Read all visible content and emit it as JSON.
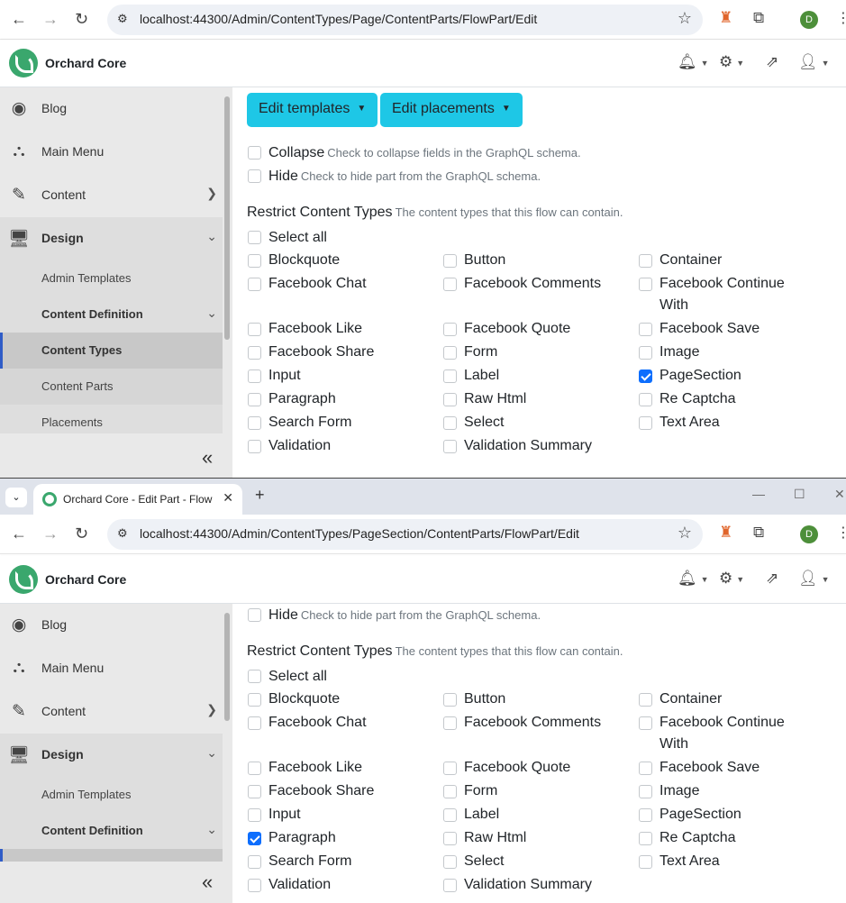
{
  "window1": {
    "url": "localhost:44300/Admin/ContentTypes/Page/ContentParts/FlowPart/Edit"
  },
  "window2": {
    "tab_title": "Orchard Core - Edit Part - Flow",
    "url": "localhost:44300/Admin/ContentTypes/PageSection/ContentParts/FlowPart/Edit"
  },
  "profile_initial": "D",
  "brand": "Orchard Core",
  "sidebar": {
    "items": [
      {
        "label": "Blog",
        "icon": "rss-icon"
      },
      {
        "label": "Main Menu",
        "icon": "sitemap-icon"
      },
      {
        "label": "Content",
        "icon": "edit-icon"
      },
      {
        "label": "Design",
        "icon": "desktop-icon"
      }
    ],
    "sub_items": [
      "Admin Templates",
      "Content Definition",
      "Content Types",
      "Content Parts",
      "Placements"
    ]
  },
  "buttons": {
    "edit_templates": "Edit templates",
    "edit_placements": "Edit placements"
  },
  "options": {
    "collapse": {
      "label": "Collapse",
      "hint": "Check to collapse fields in the GraphQL schema."
    },
    "hide": {
      "label": "Hide",
      "hint": "Check to hide part from the GraphQL schema."
    }
  },
  "restrict": {
    "title": "Restrict Content Types",
    "hint": "The content types that this flow can contain.",
    "select_all": "Select all",
    "types": [
      "Blockquote",
      "Button",
      "Container",
      "Facebook Chat",
      "Facebook Comments",
      "Facebook Continue With",
      "Facebook Like",
      "Facebook Quote",
      "Facebook Save",
      "Facebook Share",
      "Form",
      "Image",
      "Input",
      "Label",
      "PageSection",
      "Paragraph",
      "Raw Html",
      "Re Captcha",
      "Search Form",
      "Select",
      "Text Area",
      "Validation",
      "Validation Summary"
    ],
    "checked_window1": [
      "PageSection"
    ],
    "checked_window2": [
      "Paragraph"
    ]
  },
  "colors": {
    "accent": "#1ec7e6",
    "brand_green": "#3aa76d",
    "check_blue": "#0d6efd"
  }
}
